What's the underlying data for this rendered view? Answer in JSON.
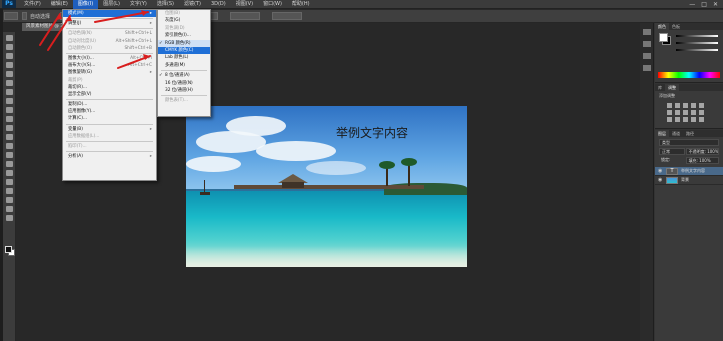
{
  "menubar": {
    "logo": "Ps",
    "items": [
      "文件(F)",
      "编辑(E)",
      "图像(I)",
      "图层(L)",
      "文字(Y)",
      "选择(S)",
      "滤镜(T)",
      "3D(D)",
      "视图(V)",
      "窗口(W)",
      "帮助(H)"
    ],
    "active_index": 2,
    "window_buttons": [
      "—",
      "□",
      "✕"
    ]
  },
  "options": {
    "auto_select": "自动选择"
  },
  "document_tab": "风景素材图片 @ 33.3%",
  "image_menu": {
    "rows": [
      {
        "label": "模式(M)",
        "shortcut": "",
        "submenu": true,
        "state": "highlight"
      },
      {
        "sep": true
      },
      {
        "label": "调整(J)",
        "shortcut": "",
        "submenu": true,
        "state": "normal"
      },
      {
        "sep": true
      },
      {
        "label": "自动色调(N)",
        "shortcut": "Shift+Ctrl+L",
        "state": "disabled"
      },
      {
        "label": "自动对比度(U)",
        "shortcut": "Alt+Shift+Ctrl+L",
        "state": "disabled"
      },
      {
        "label": "自动颜色(O)",
        "shortcut": "Shift+Ctrl+B",
        "state": "disabled"
      },
      {
        "sep": true
      },
      {
        "label": "图像大小(I)...",
        "shortcut": "Alt+Ctrl+I",
        "state": "normal"
      },
      {
        "label": "画布大小(S)...",
        "shortcut": "Alt+Ctrl+C",
        "state": "normal"
      },
      {
        "label": "图像旋转(G)",
        "shortcut": "",
        "submenu": true,
        "state": "normal"
      },
      {
        "label": "裁剪(P)",
        "shortcut": "",
        "state": "disabled"
      },
      {
        "label": "裁切(R)...",
        "shortcut": "",
        "state": "normal"
      },
      {
        "label": "显示全部(V)",
        "shortcut": "",
        "state": "normal"
      },
      {
        "sep": true
      },
      {
        "label": "复制(D)...",
        "shortcut": "",
        "state": "normal"
      },
      {
        "label": "应用图像(Y)...",
        "shortcut": "",
        "state": "normal"
      },
      {
        "label": "计算(C)...",
        "shortcut": "",
        "state": "normal"
      },
      {
        "sep": true
      },
      {
        "label": "变量(B)",
        "shortcut": "",
        "submenu": true,
        "state": "normal"
      },
      {
        "label": "应用数据组(L)...",
        "shortcut": "",
        "state": "disabled"
      },
      {
        "sep": true
      },
      {
        "label": "陷印(T)...",
        "shortcut": "",
        "state": "disabled"
      },
      {
        "sep": true
      },
      {
        "label": "分析(A)",
        "shortcut": "",
        "submenu": true,
        "state": "normal"
      }
    ]
  },
  "mode_menu": {
    "rows": [
      {
        "label": "位图(B)",
        "state": "disabled",
        "check": false
      },
      {
        "label": "灰度(G)",
        "state": "normal",
        "check": false
      },
      {
        "label": "双色调(D)",
        "state": "disabled",
        "check": false
      },
      {
        "label": "索引颜色(I)...",
        "state": "normal",
        "check": false
      },
      {
        "label": "RGB 颜色(R)",
        "state": "normal",
        "check": true
      },
      {
        "label": "CMYK 颜色(C)",
        "state": "highlight",
        "check": false
      },
      {
        "label": "Lab 颜色(L)",
        "state": "normal",
        "check": false
      },
      {
        "label": "多通道(M)",
        "state": "normal",
        "check": false
      },
      {
        "sep": true
      },
      {
        "label": "8 位/通道(A)",
        "state": "normal",
        "check": true
      },
      {
        "label": "16 位/通道(N)",
        "state": "normal",
        "check": false
      },
      {
        "label": "32 位/通道(H)",
        "state": "normal",
        "check": false
      },
      {
        "sep": true
      },
      {
        "label": "颜色表(T)...",
        "state": "disabled",
        "check": false
      }
    ]
  },
  "canvas": {
    "caption": "举例文字内容"
  },
  "panels": {
    "color_tabs": [
      "颜色",
      "色板"
    ],
    "adjust_tabs": [
      "库",
      "调整"
    ],
    "adjust_label": "添加调整",
    "layer_tabs": [
      "图层",
      "通道",
      "路径"
    ],
    "kind_label": "类型",
    "blend_mode": "正常",
    "opacity_label": "不透明度: 100%",
    "lock_label": "锁定:",
    "fill_label": "填充: 100%",
    "layers": [
      {
        "name": "举例文字内容",
        "type": "text",
        "selected": true
      },
      {
        "name": "背景",
        "type": "image",
        "selected": false
      }
    ]
  },
  "colors": {
    "menu_highlight": "#1f6fd6",
    "annotation_arrow": "#d81e1e"
  }
}
